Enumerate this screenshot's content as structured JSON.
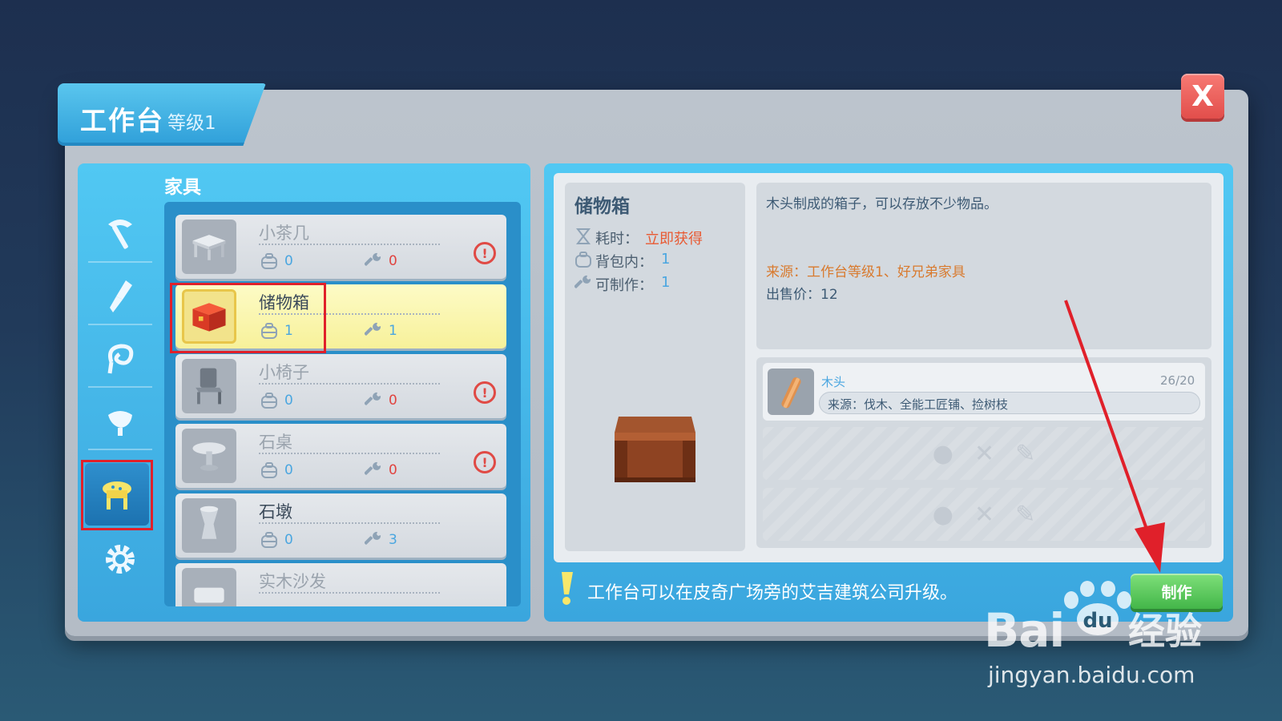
{
  "window": {
    "title": "工作台",
    "level": "等级1",
    "close_label": "X"
  },
  "category": {
    "title": "家具",
    "tabs": [
      {
        "icon": "pickaxe-icon"
      },
      {
        "icon": "tool-icon"
      },
      {
        "icon": "rope-icon"
      },
      {
        "icon": "bowl-icon"
      },
      {
        "icon": "furniture-icon",
        "selected": true
      },
      {
        "icon": "gear-icon"
      }
    ]
  },
  "items": [
    {
      "name": "小茶几",
      "bag": "0",
      "craftable": "0",
      "warning": true
    },
    {
      "name": "储物箱",
      "bag": "1",
      "craftable": "1",
      "warning": false,
      "selected": true
    },
    {
      "name": "小椅子",
      "bag": "0",
      "craftable": "0",
      "warning": true
    },
    {
      "name": "石桌",
      "bag": "0",
      "craftable": "0",
      "warning": true
    },
    {
      "name": "石墩",
      "bag": "0",
      "craftable": "3",
      "warning": false
    },
    {
      "name": "实木沙发"
    }
  ],
  "detail": {
    "name": "储物箱",
    "time_label": "耗时：",
    "time_value": "立即获得",
    "bag_label": "背包内：",
    "bag_value": "1",
    "craft_label": "可制作：",
    "craft_value": "1",
    "description": "木头制成的箱子，可以存放不少物品。",
    "source": "来源：工作台等级1、好兄弟家具",
    "price": "出售价：12"
  },
  "materials": [
    {
      "name": "木头",
      "count": "26/20",
      "source": "来源：伐木、全能工匠铺、捡树枝"
    }
  ],
  "tip": "工作台可以在皮奇广场旁的艾吉建筑公司升级。",
  "make_button": "制作",
  "watermark": {
    "logo": "Bai  经验",
    "brand_prefix": "Bai",
    "brand_suffix": "经验",
    "url": "jingyan.baidu.com"
  },
  "colors": {
    "panel_blue": "#3aa6de",
    "highlight_red": "#e0202a",
    "make_green": "#43b649",
    "orange_text": "#e85a33"
  }
}
